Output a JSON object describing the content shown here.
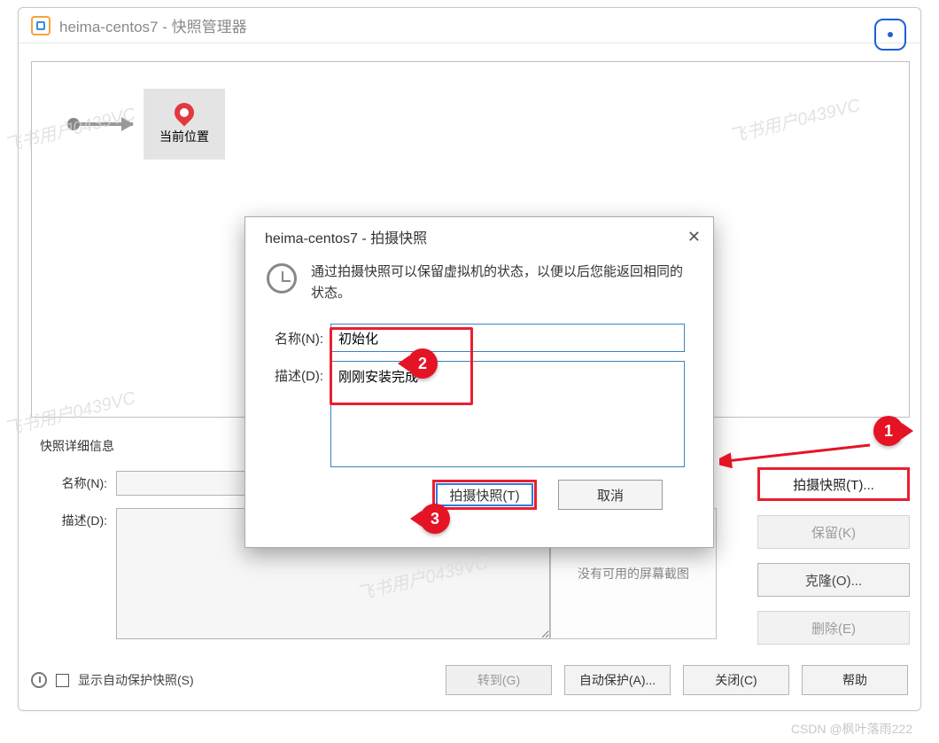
{
  "window": {
    "title": "heima-centos7 - 快照管理器"
  },
  "timeline": {
    "current_label": "当前位置"
  },
  "details": {
    "section_title": "快照详细信息",
    "name_label": "名称(N):",
    "desc_label": "描述(D):",
    "name_value": "",
    "desc_value": "",
    "no_thumb_text": "没有可用的屏幕截图"
  },
  "side_buttons": {
    "take": "拍摄快照(T)...",
    "keep": "保留(K)",
    "clone": "克隆(O)...",
    "delete": "删除(E)"
  },
  "bottom": {
    "autoprotect_checkbox_label": "显示自动保护快照(S)",
    "goto": "转到(G)",
    "autoprotect": "自动保护(A)...",
    "close": "关闭(C)",
    "help": "帮助"
  },
  "dialog": {
    "title": "heima-centos7 - 拍摄快照",
    "info_text": "通过拍摄快照可以保留虚拟机的状态，以便以后您能返回相同的状态。",
    "name_label": "名称(N):",
    "desc_label": "描述(D):",
    "name_value": "初始化",
    "desc_value": "刚刚安装完成",
    "take_btn": "拍摄快照(T)",
    "cancel_btn": "取消"
  },
  "annotations": {
    "badge1": "1",
    "badge2": "2",
    "badge3": "3"
  },
  "watermarks": {
    "w1": "飞书用户0439VC",
    "w2": "飞书用户0439VC",
    "w3": "飞书用户0439VC",
    "w4": "飞书用户0439VC",
    "credit": "CSDN @枫叶落雨222"
  }
}
